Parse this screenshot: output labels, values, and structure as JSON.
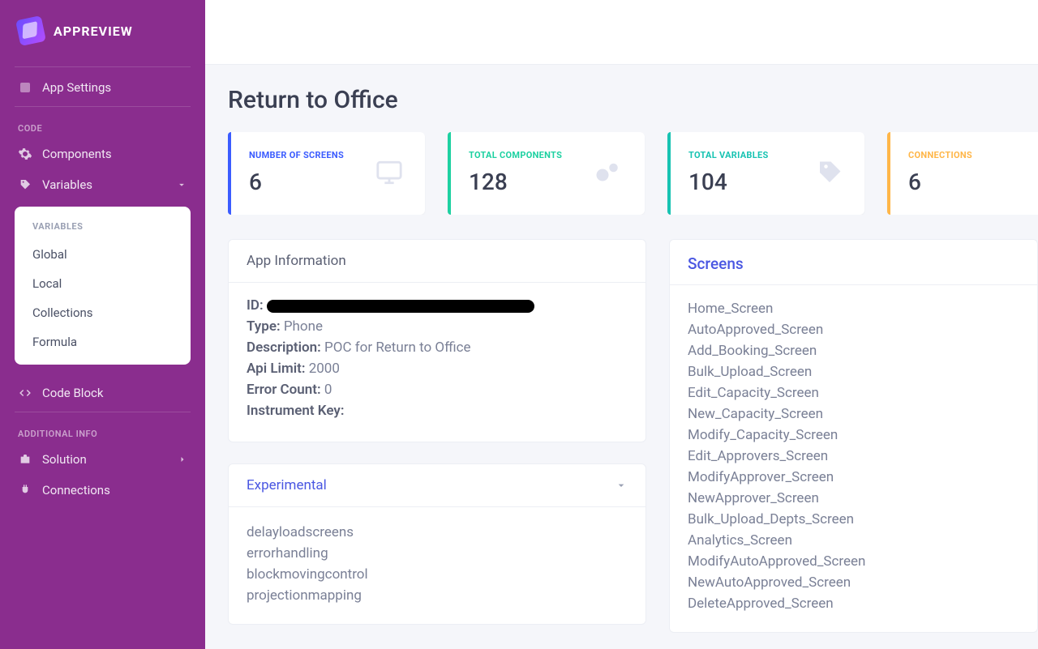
{
  "brand": {
    "title": "APPREVIEW"
  },
  "sidebar": {
    "appSettings": "App Settings",
    "codeHeading": "CODE",
    "components": "Components",
    "variables": "Variables",
    "submenu": {
      "heading": "VARIABLES",
      "items": [
        "Global",
        "Local",
        "Collections",
        "Formula"
      ]
    },
    "codeBlock": "Code Block",
    "addlHeading": "ADDITIONAL INFO",
    "solution": "Solution",
    "connections": "Connections"
  },
  "page": {
    "title": "Return to Office"
  },
  "stats": {
    "screens": {
      "label": "NUMBER OF SCREENS",
      "value": "6"
    },
    "components": {
      "label": "TOTAL COMPONENTS",
      "value": "128"
    },
    "variables": {
      "label": "TOTAL VARIABLES",
      "value": "104"
    },
    "connections": {
      "label": "CONNECTIONS",
      "value": "6"
    }
  },
  "appInfo": {
    "header": "App Information",
    "idLabel": "ID:",
    "typeLabel": "Type:",
    "typeValue": "Phone",
    "descLabel": "Description:",
    "descValue": "POC for Return to Office",
    "apiLabel": "Api Limit:",
    "apiValue": "2000",
    "errLabel": "Error Count:",
    "errValue": "0",
    "instrLabel": "Instrument Key:",
    "instrValue": ""
  },
  "experimental": {
    "header": "Experimental",
    "items": [
      "delayloadscreens",
      "errorhandling",
      "blockmovingcontrol",
      "projectionmapping"
    ]
  },
  "screens": {
    "header": "Screens",
    "items": [
      "Home_Screen",
      "AutoApproved_Screen",
      "Add_Booking_Screen",
      "Bulk_Upload_Screen",
      "Edit_Capacity_Screen",
      "New_Capacity_Screen",
      "Modify_Capacity_Screen",
      "Edit_Approvers_Screen",
      "ModifyApprover_Screen",
      "NewApprover_Screen",
      "Bulk_Upload_Depts_Screen",
      "Analytics_Screen",
      "ModifyAutoApproved_Screen",
      "NewAutoApproved_Screen",
      "DeleteApproved_Screen"
    ]
  }
}
